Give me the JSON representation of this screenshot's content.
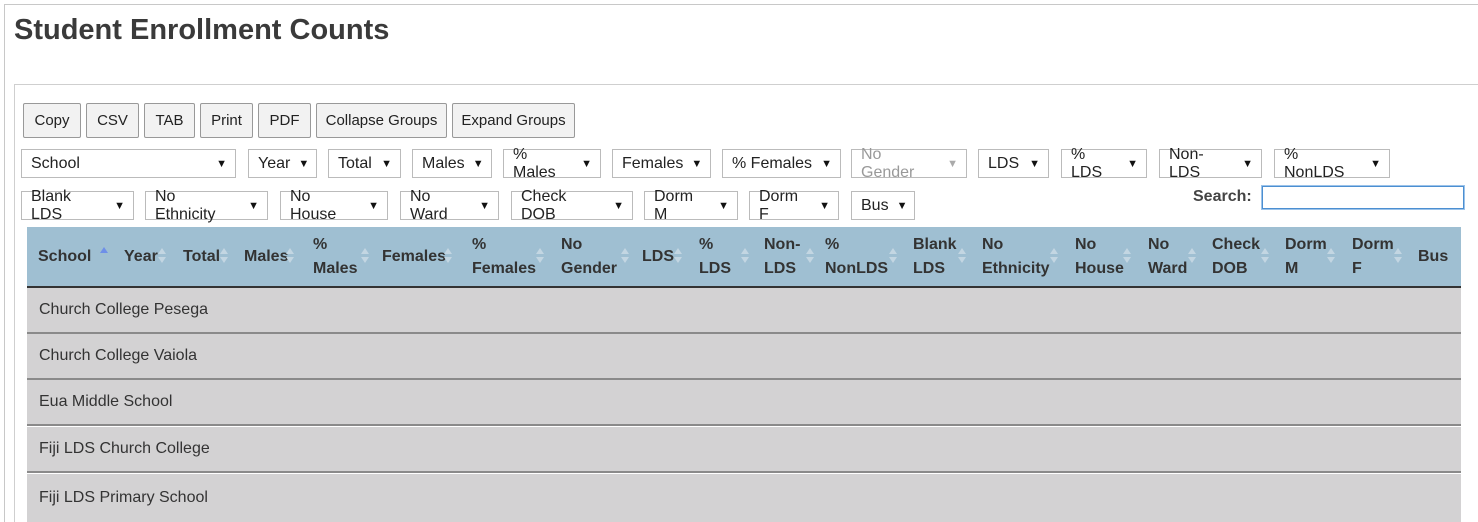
{
  "page": {
    "title": "Student Enrollment Counts"
  },
  "toolbar": {
    "buttons": [
      "Copy",
      "CSV",
      "TAB",
      "Print",
      "PDF",
      "Collapse Groups",
      "Expand Groups"
    ]
  },
  "filters": {
    "row1": [
      "School",
      "Year",
      "Total",
      "Males",
      "% Males",
      "Females",
      "% Females",
      "No Gender",
      "LDS",
      "% LDS",
      "Non-LDS",
      "% NonLDS"
    ],
    "row2": [
      "Blank LDS",
      "No Ethnicity",
      "No House",
      "No Ward",
      "Check DOB",
      "Dorm M",
      "Dorm F",
      "Bus"
    ],
    "arrow": "▼",
    "disabled": [
      "No Gender"
    ]
  },
  "search": {
    "label": "Search:",
    "value": ""
  },
  "table": {
    "columns": [
      {
        "l1": "School",
        "l2": ""
      },
      {
        "l1": "Year",
        "l2": ""
      },
      {
        "l1": "Total",
        "l2": ""
      },
      {
        "l1": "Males",
        "l2": ""
      },
      {
        "l1": "%",
        "l2": "Males"
      },
      {
        "l1": "Females",
        "l2": ""
      },
      {
        "l1": "%",
        "l2": "Females"
      },
      {
        "l1": "No",
        "l2": "Gender"
      },
      {
        "l1": "LDS",
        "l2": ""
      },
      {
        "l1": "%",
        "l2": "LDS"
      },
      {
        "l1": "Non-",
        "l2": "LDS"
      },
      {
        "l1": "%",
        "l2": "NonLDS"
      },
      {
        "l1": "Blank",
        "l2": "LDS"
      },
      {
        "l1": "No",
        "l2": "Ethnicity"
      },
      {
        "l1": "No",
        "l2": "House"
      },
      {
        "l1": "No",
        "l2": "Ward"
      },
      {
        "l1": "Check",
        "l2": "DOB"
      },
      {
        "l1": "Dorm",
        "l2": "M"
      },
      {
        "l1": "Dorm",
        "l2": "F"
      },
      {
        "l1": "Bus",
        "l2": ""
      }
    ],
    "sorted_column": "School",
    "group_rows": [
      "Church College Pesega",
      "Church College Vaiola",
      "Eua Middle School",
      "Fiji LDS Church College",
      "Fiji LDS Primary School"
    ]
  },
  "colors": {
    "header_bg": "#9fbfd2",
    "row_bg": "#d3d2d3",
    "sort_active": "#6e8fe8"
  }
}
